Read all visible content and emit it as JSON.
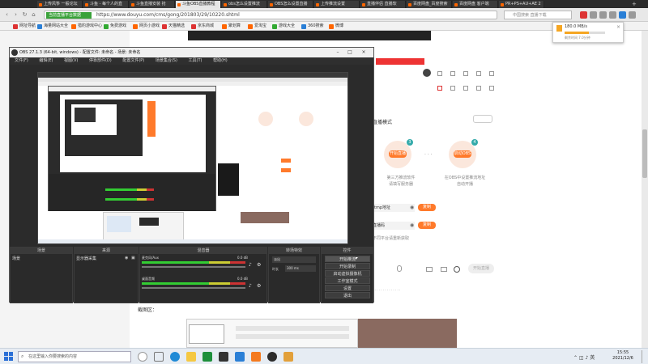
{
  "browser": {
    "tabs": [
      {
        "label": "上传风筝 一般论坛"
      },
      {
        "label": "斗鱼 - 每个人的直"
      },
      {
        "label": "斗鱼直播安装 抢"
      },
      {
        "label": "斗鱼OBS直播教程"
      },
      {
        "label": "obs怎么设置推流"
      },
      {
        "label": "OBS怎么设置直播"
      },
      {
        "label": "上传推流设置"
      },
      {
        "label": "直播伴侣 直播软"
      },
      {
        "label": "百度网盘_百度搜索"
      },
      {
        "label": "百度网盘 客户端"
      },
      {
        "label": "PR+PS+AU+AE 2"
      }
    ],
    "url_badge": "当前直播平台数据",
    "url": "https://www.douyu.com/cms/gong/201803/29/10220.shtml",
    "search_placeholder": "中国搜索 直播下载",
    "bookmarks": [
      "网址导航",
      "海量网站大全",
      "猎豹游戏中心",
      "免费游戏",
      "网页小游戏",
      "天猫精选",
      "京东商城",
      "聚划算",
      "爱淘宝",
      "游戏大全",
      "360搜索",
      "微博",
      "360导航",
      "猜你喜欢"
    ]
  },
  "download": {
    "title": "180.0 MB/s",
    "sub": "剩余时间 7.0分钟",
    "progress": 0.6
  },
  "obs": {
    "title": "OBS 27.1.3 (64-bit, windows) - 配置文件: 未命名 - 场景: 未命名",
    "menu": [
      "文件(F)",
      "编辑(E)",
      "视图(V)",
      "停靠部件(D)",
      "配置文件(P)",
      "场景集合(S)",
      "工具(T)",
      "帮助(H)"
    ],
    "docks": {
      "scenes": {
        "title": "场景",
        "item": "场景"
      },
      "sources": {
        "title": "来源",
        "item": "显示器采集"
      },
      "mixer": {
        "title": "混音器",
        "ch1": "桌面音频",
        "ch1_db": "0.0 dB",
        "ch2": "麦克风/Aux",
        "ch2_db": "0.0 dB"
      },
      "transitions": {
        "title": "转场特效",
        "type": "淡出",
        "duration_label": "时长",
        "duration": "300 ms"
      },
      "controls": {
        "title": "控件",
        "buttons": [
          "开始推流",
          "开始录制",
          "启动虚拟摄像机",
          "工作室模式",
          "设置",
          "退出"
        ]
      }
    }
  },
  "article": {
    "heading": "直播模式",
    "left_step": {
      "badge": "开始直播",
      "line1": "第三方推流软件",
      "line2": "请填写服务器"
    },
    "right_step": {
      "badge": "启动OBS",
      "line1": "在OBS中设置推流地址",
      "line2": "自动开播"
    },
    "fields": [
      {
        "label": "rtmp地址",
        "btn": "复制"
      },
      {
        "label": "直播码",
        "btn": "复制"
      }
    ],
    "note": "不同平台请重新获取",
    "bottom_caption": "截图区：",
    "footer_button": "开始直播"
  },
  "taskbar": {
    "search_placeholder": "在这里输入你要搜索的内容",
    "time": "15:55",
    "date": "2021/12/6"
  }
}
